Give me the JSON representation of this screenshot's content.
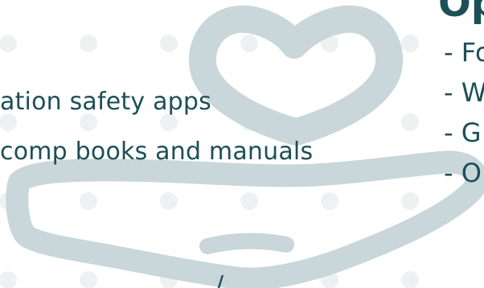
{
  "left_text": {
    "line_1": "ation safety apps",
    "line_2": "comp books and manuals"
  },
  "right_column": {
    "heading": "Op",
    "items": [
      "- Fo",
      "- W",
      "- G",
      "- O"
    ]
  },
  "bottom_text": {
    "line_1": "/"
  },
  "icons": {
    "heart": "heart-icon",
    "hand": "open-hand-icon"
  },
  "colors": {
    "text": "#1d4f57",
    "illustration": "#c9d6da",
    "dots": "#eef1f2",
    "background": "#ffffff"
  }
}
